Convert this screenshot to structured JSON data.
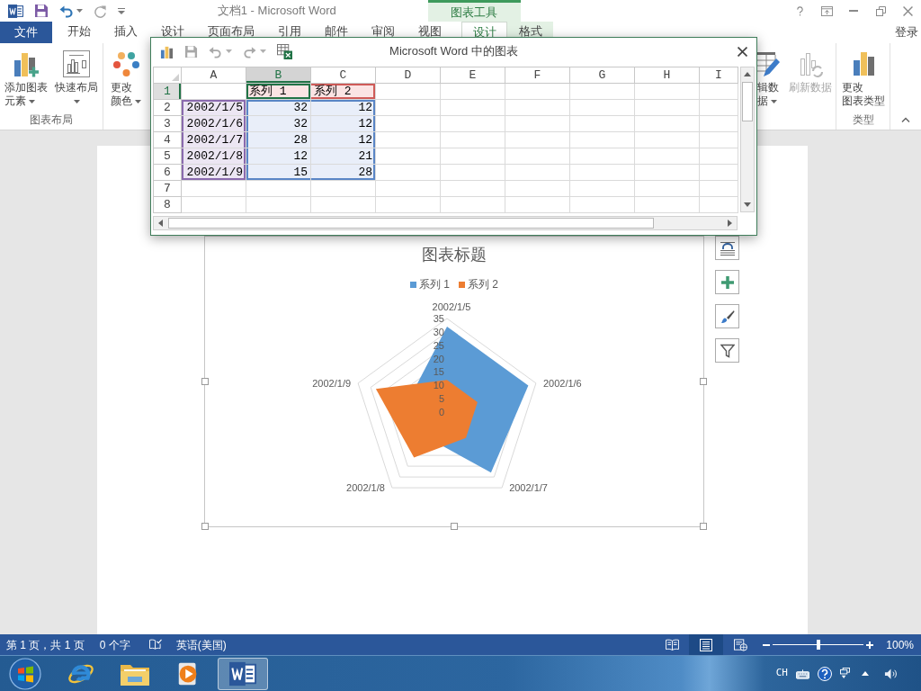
{
  "title_bar": {
    "title": "文档1 - Microsoft Word",
    "contextual_group": "图表工具"
  },
  "tabs": [
    {
      "label": "文件",
      "kind": "file",
      "selected": false
    },
    {
      "label": "开始",
      "kind": "main",
      "selected": false
    },
    {
      "label": "插入",
      "kind": "main",
      "selected": false
    },
    {
      "label": "设计",
      "kind": "main",
      "selected": false
    },
    {
      "label": "页面布局",
      "kind": "main",
      "selected": false
    },
    {
      "label": "引用",
      "kind": "main",
      "selected": false
    },
    {
      "label": "邮件",
      "kind": "main",
      "selected": false
    },
    {
      "label": "审阅",
      "kind": "main",
      "selected": false
    },
    {
      "label": "视图",
      "kind": "main",
      "selected": false
    },
    {
      "label": "设计",
      "kind": "contextual",
      "selected": true
    },
    {
      "label": "格式",
      "kind": "contextual",
      "selected": false
    }
  ],
  "account": {
    "label": "登录"
  },
  "ribbon_groups": [
    {
      "label": "图表布局",
      "buttons": [
        {
          "lines": [
            "添加图表",
            "元素"
          ],
          "dropdown": true,
          "disabled": false
        },
        {
          "lines": [
            "快速布局"
          ],
          "dropdown": true,
          "disabled": false
        }
      ]
    },
    {
      "buttons": [
        {
          "lines": [
            "更改",
            "颜色"
          ],
          "dropdown": true,
          "disabled": false
        }
      ]
    },
    {
      "buttons": [
        {
          "lines": [
            "辑数",
            "据"
          ],
          "dropdown": true,
          "disabled": false
        },
        {
          "lines": [
            "刷新数据"
          ],
          "dropdown": false,
          "disabled": true
        }
      ]
    },
    {
      "label": "类型",
      "buttons": [
        {
          "lines": [
            "更改",
            "图表类型"
          ],
          "dropdown": false,
          "disabled": false
        }
      ]
    }
  ],
  "spreadsheet": {
    "title": "Microsoft Word 中的图表",
    "columns": [
      {
        "label": "A",
        "selected": false
      },
      {
        "label": "B",
        "selected": true
      },
      {
        "label": "C",
        "selected": false
      },
      {
        "label": "D",
        "selected": false
      },
      {
        "label": "E",
        "selected": false
      },
      {
        "label": "F",
        "selected": false
      },
      {
        "label": "G",
        "selected": false
      },
      {
        "label": "H",
        "selected": false
      },
      {
        "label": "I",
        "selected": false
      }
    ],
    "rows": [
      {
        "header": "1",
        "selected": true,
        "cells": [
          {
            "kind": "plain",
            "selected": false
          },
          {
            "kind": "name",
            "selected": true,
            "text": "系列 1"
          },
          {
            "kind": "name",
            "selected": false,
            "text": "系列 2"
          }
        ]
      },
      {
        "header": "2",
        "selected": false,
        "cells": [
          {
            "kind": "category",
            "selected": false,
            "text": "2002/1/5"
          },
          {
            "kind": "value",
            "selected": false,
            "text": "32"
          },
          {
            "kind": "value",
            "selected": false,
            "text": "12"
          }
        ]
      },
      {
        "header": "3",
        "selected": false,
        "cells": [
          {
            "kind": "category",
            "selected": false,
            "text": "2002/1/6"
          },
          {
            "kind": "value",
            "selected": false,
            "text": "32"
          },
          {
            "kind": "value",
            "selected": false,
            "text": "12"
          }
        ]
      },
      {
        "header": "4",
        "selected": false,
        "cells": [
          {
            "kind": "category",
            "selected": false,
            "text": "2002/1/7"
          },
          {
            "kind": "value",
            "selected": false,
            "text": "28"
          },
          {
            "kind": "value",
            "selected": false,
            "text": "12"
          }
        ]
      },
      {
        "header": "5",
        "selected": false,
        "cells": [
          {
            "kind": "category",
            "selected": false,
            "text": "2002/1/8"
          },
          {
            "kind": "value",
            "selected": false,
            "text": "12"
          },
          {
            "kind": "value",
            "selected": false,
            "text": "21"
          }
        ]
      },
      {
        "header": "6",
        "selected": false,
        "cells": [
          {
            "kind": "category",
            "selected": false,
            "text": "2002/1/9"
          },
          {
            "kind": "value",
            "selected": false,
            "text": "15"
          },
          {
            "kind": "value",
            "selected": false,
            "text": "28"
          }
        ]
      },
      {
        "header": "7",
        "selected": false
      },
      {
        "header": "8",
        "selected": false
      }
    ]
  },
  "chart": {
    "chart_data": {
      "type": "radar",
      "title": "图表标题",
      "legend": "top",
      "categories": [
        "2002/1/5",
        "2002/1/6",
        "2002/1/7",
        "2002/1/8",
        "2002/1/9"
      ],
      "series": [
        {
          "name": "系列 1",
          "color": "#5b9bd5",
          "values": [
            32,
            32,
            28,
            12,
            15
          ]
        },
        {
          "name": "系列 2",
          "color": "#ed7d31",
          "values": [
            12,
            12,
            12,
            21,
            28
          ]
        }
      ],
      "ylim": [
        0,
        35
      ],
      "yticks": [
        0,
        5,
        10,
        15,
        20,
        25,
        30,
        35
      ]
    }
  },
  "status_bar": {
    "page_info": "第 1 页，共 1 页",
    "word_count": "0 个字",
    "language": "英语(美国)",
    "views": [
      {
        "selected": false
      },
      {
        "selected": true
      },
      {
        "selected": false
      }
    ],
    "zoom": {
      "level": 0.5,
      "reading": "100%"
    }
  },
  "taskbar": {
    "apps": [
      {
        "selected": false
      },
      {
        "selected": false
      },
      {
        "selected": false
      },
      {
        "selected": true
      }
    ],
    "input_language": "CH"
  }
}
